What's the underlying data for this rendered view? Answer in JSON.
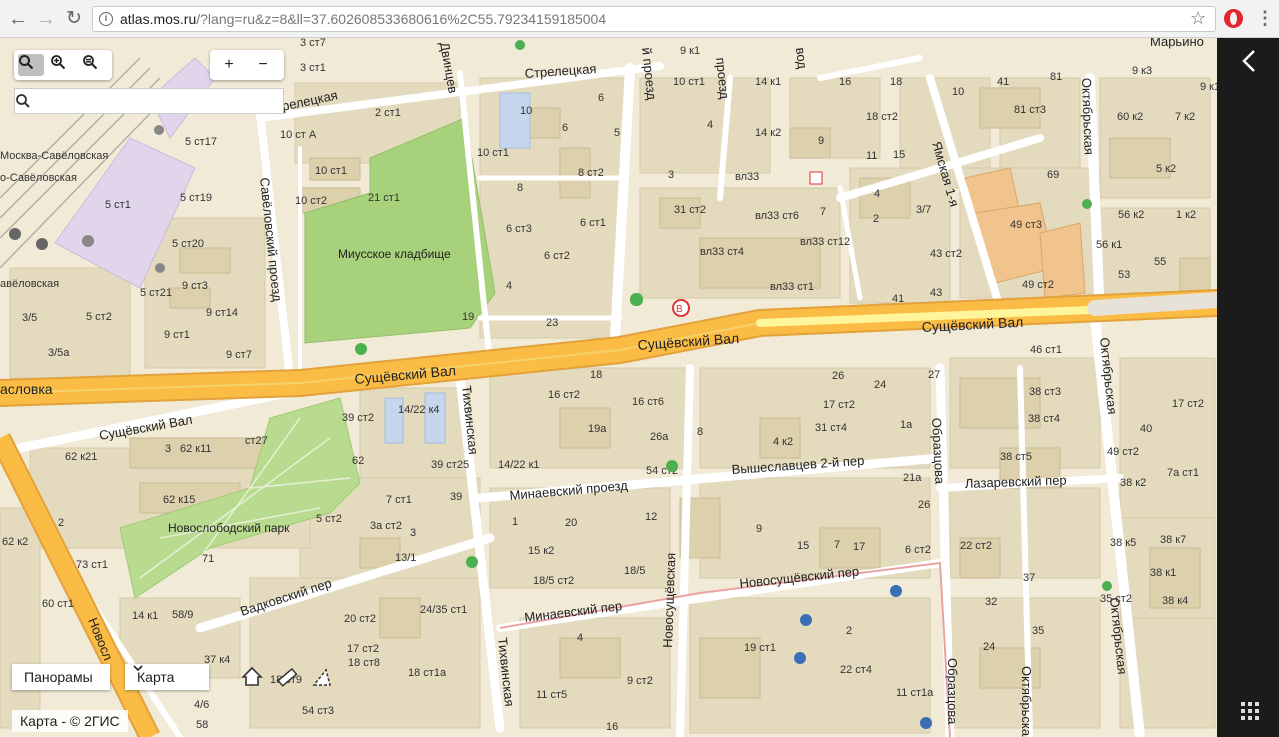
{
  "browser": {
    "back_icon": "arrow-left-icon",
    "forward_icon": "arrow-right-icon",
    "reload_icon": "reload-icon",
    "url_host": "atlas.mos.ru",
    "url_rest": "/?lang=ru&z=8&ll=37.602608533680616%2C55.79234159185004"
  },
  "map": {
    "search_placeholder": "",
    "panorama_label": "Панорамы",
    "layer_label": "Карта",
    "copyright": "Карта - © 2ГИС",
    "zoom_in": "+",
    "zoom_out": "−",
    "streets": {
      "streletskaya_top": "Стрелецкая",
      "streletskaya_left": "Стрелецкая",
      "dvintsev": "Двинцев",
      "savelovsky_proezd": "Савёловский проезд",
      "suschevsky_val_center": "Сущёвский Вал",
      "suschevsky_val_right": "Сущёвский Вал",
      "suschevsky_val_left": "Сущёвский Вал",
      "savelovskaya_road": "асловка",
      "tikhvinskaya": "Тихвинская",
      "tikhvinskaya_bottom": "Тихвинская",
      "minaevsky_proezd": "Минаевский проезд",
      "vyshslavtsev": "Вышеславцев 2-й пер",
      "lazarevsky": "Лазаревский пер",
      "obraztsova": "Образцова",
      "obraztsova_bottom": "Образцова",
      "oktyabrskaya_top": "Октябрьская",
      "oktyabrskaya_mid": "Октябрьская",
      "oktyabrskaya_bottom": "Октябрьская",
      "oktyabrskaya_low": "Октябрьская",
      "yamskaya": "Ямская 1-я",
      "vadkovsky": "Вадковский пер",
      "novosuschevsky_per": "Новосущёвский пер",
      "novosuschevskaya": "Новосущёвская",
      "minaevsky_per": "Минаевский пер",
      "novoslobodskaya": "Новосл",
      "maryino": "Марьино",
      "proezd_top": "й проезд",
      "proezd_top2": "проезд",
      "proezd_top3": "вод"
    },
    "places": {
      "cemetery": "Миусское кладбище",
      "park": "Новослободский парк",
      "station1": "Москва-Савёловская",
      "station2": "о-Савёловская",
      "station3": "авёловская"
    },
    "labels": [
      "3 ст7",
      "3 ст1",
      "2 ст1",
      "10 ст А",
      "10 ст1",
      "10 ст2",
      "21 ст1",
      "19",
      "5 ст17",
      "5 ст19",
      "5 ст1",
      "5 ст20",
      "9 ст3",
      "5 ст21",
      "9 ст14",
      "5 ст2",
      "9 ст1",
      "9 ст7",
      "3/5",
      "3/5а",
      "10",
      "6",
      "5",
      "8",
      "8 ст2",
      "10 ст1",
      "6",
      "4",
      "3",
      "4",
      "7",
      "6 ст3",
      "6 ст1",
      "6 ст2",
      "23",
      "31 ст2",
      "вл33",
      "вл33 ст6",
      "вл33 ст4",
      "вл33 ст12",
      "вл33 ст1",
      "9 к1",
      "10 ст1",
      "14 к1",
      "16",
      "18",
      "14 к2",
      "9",
      "11",
      "15",
      "18 ст2",
      "4",
      "2",
      "3/7",
      "43 ст2",
      "43",
      "41",
      "10",
      "41",
      "81",
      "81 ст3",
      "9 к3",
      "9 к1",
      "60 к2",
      "7 к2",
      "5 к2",
      "69",
      "49 ст3",
      "56 к2",
      "1 к2",
      "56 к1",
      "53",
      "55",
      "49 ст2",
      "46 ст1",
      "38 ст3",
      "38 ст4",
      "17 ст2",
      "40",
      "49 ст2",
      "38 ст5",
      "38 к2",
      "38 к7",
      "38 к1",
      "38 к4",
      "38 к5",
      "37",
      "35 ст2",
      "35",
      "32",
      "24",
      "22 ст2",
      "26",
      "21а",
      "1а",
      "27",
      "26",
      "24",
      "31 ст4",
      "4 к2",
      "8",
      "26а",
      "19а",
      "16 ст6",
      "18",
      "16 ст2",
      "14/22 к1",
      "14/22 к4",
      "39 ст2",
      "62",
      "39 ст25",
      "39",
      "7 ст1",
      "5 ст2",
      "3а ст2",
      "3",
      "62 к11",
      "ст27",
      "62 к15",
      "62 к21",
      "2",
      "62 к2",
      "73 ст1",
      "60 ст1",
      "71",
      "58/9",
      "1",
      "20",
      "15 к2",
      "18/5 ст2",
      "18/5",
      "3",
      "13/1",
      "24/35 ст1",
      "20 ст2",
      "17 ст2",
      "18 ст8",
      "18 ст9",
      "18 ст1а",
      "12",
      "9",
      "15",
      "7",
      "17",
      "6 ст2",
      "4",
      "19 ст1",
      "2",
      "22 ст4",
      "11 ст1а",
      "11 ст5",
      "9 ст2",
      "16",
      "37 к4",
      "14 к1",
      "4/6",
      "58",
      "54 ст3",
      "54 ст2",
      "7а ст1",
      "17 ст2",
      "5",
      "11",
      "2",
      "16",
      "10 ст1",
      "7 ст1"
    ]
  },
  "side_panel": {
    "back_icon": "chevron-left-icon",
    "grid_icon": "apps-grid-icon"
  }
}
